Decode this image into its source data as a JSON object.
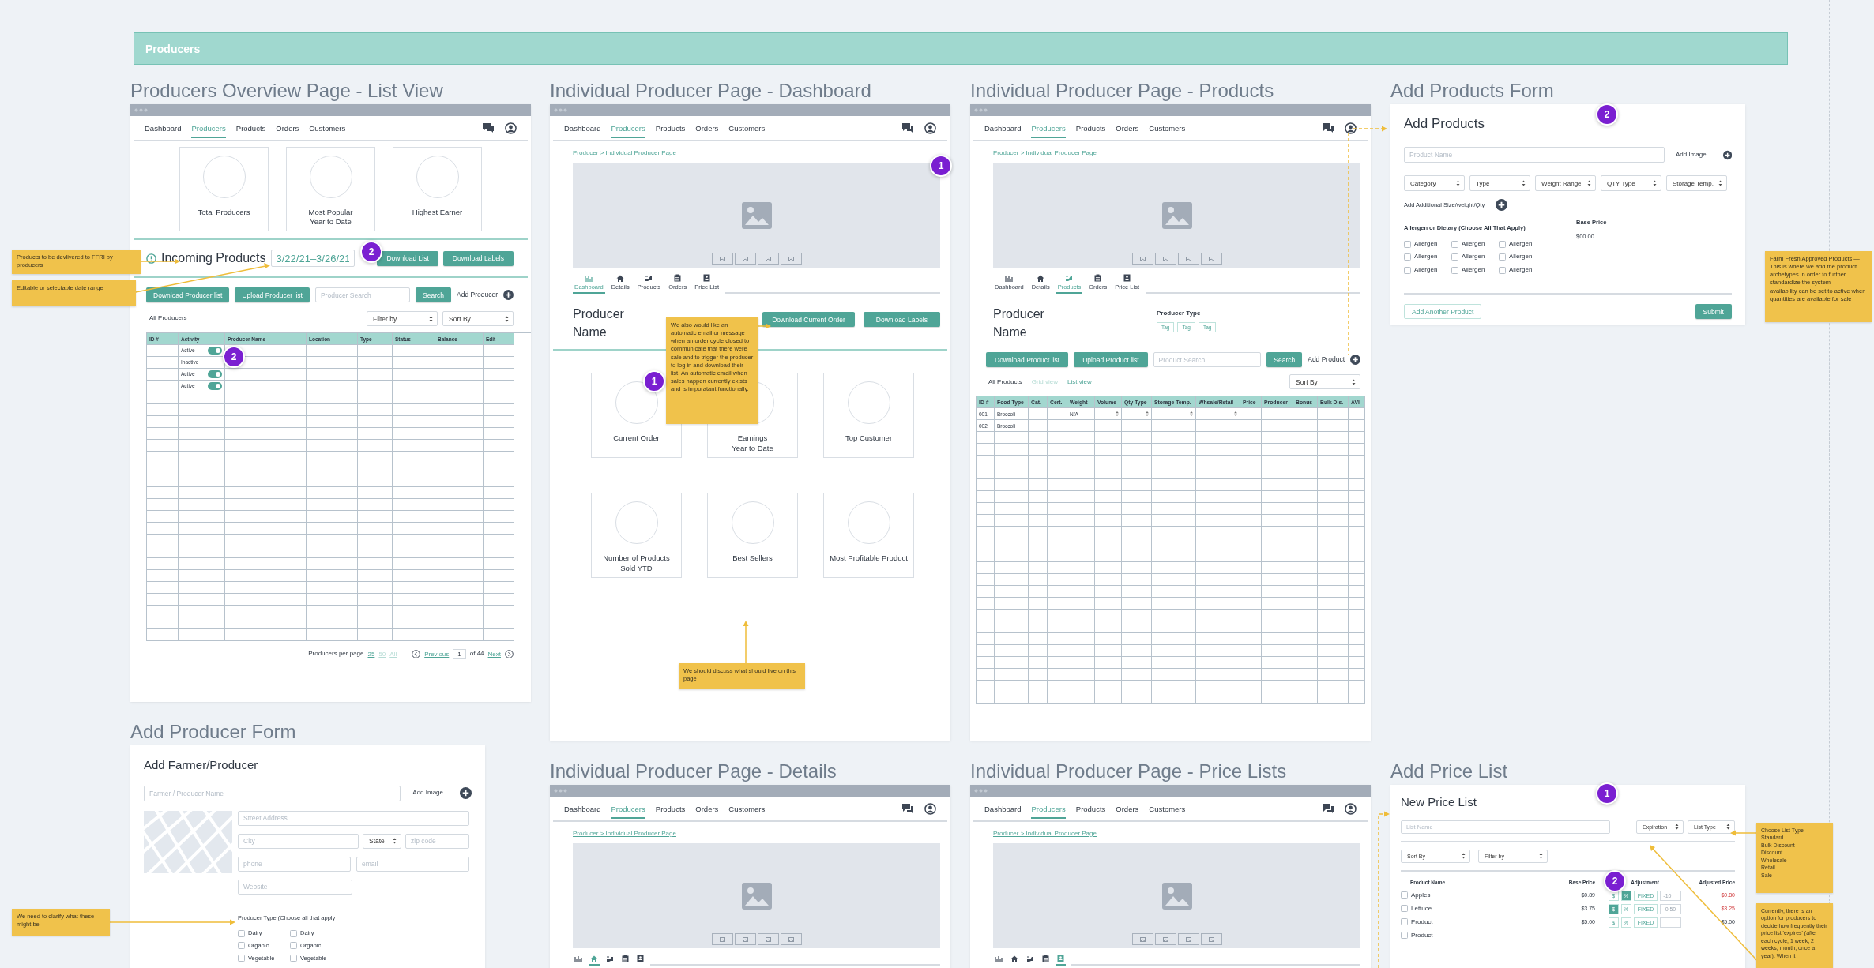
{
  "banner": {
    "title": "Producers"
  },
  "list_view": {
    "title": "Producers Overview Page - List View",
    "nav": [
      {
        "label": "Dashboard",
        "selected": false
      },
      {
        "label": "Producers",
        "selected": true
      },
      {
        "label": "Products",
        "selected": false
      },
      {
        "label": "Orders",
        "selected": false
      },
      {
        "label": "Customers",
        "selected": false
      }
    ],
    "stats": [
      "Total Producers",
      "Most Popular\nYear to Date",
      "Highest Earner"
    ],
    "incoming": {
      "label": "Incoming Products",
      "date_range": "3/22/21–3/26/21",
      "buttons": [
        "Download List",
        "Download Labels"
      ]
    },
    "actions": {
      "buttons": [
        "Download Producer list",
        "Upload Producer list"
      ],
      "search": {
        "placeholder": "Producer Search"
      },
      "search_button": "Search",
      "add": "Add Producer"
    },
    "list_label": "All Producers",
    "filters": [
      "Filter by",
      "Sort By"
    ],
    "table": {
      "columns": [
        "ID #",
        "Activity",
        "Producer Name",
        "Location",
        "Type",
        "Status",
        "Balance",
        "Edit"
      ],
      "rows": [
        {
          "activity": "Active",
          "on": true
        },
        {
          "activity": "Inactive"
        },
        {
          "activity": "Active",
          "on": true
        },
        {
          "activity": "Active",
          "on": true
        }
      ]
    },
    "pagination": {
      "label": "Producers per page",
      "sizes": [
        {
          "label": "25",
          "selected": true
        },
        {
          "label": "50",
          "selected": false
        },
        {
          "label": "All",
          "selected": false
        }
      ],
      "previous": "Previous",
      "page": "1",
      "of": "of 44",
      "next": "Next"
    }
  },
  "dashboard": {
    "title": "Individual Producer Page - Dashboard",
    "nav": [
      {
        "label": "Dashboard",
        "selected": false
      },
      {
        "label": "Producers",
        "selected": true
      },
      {
        "label": "Products",
        "selected": false
      },
      {
        "label": "Orders",
        "selected": false
      },
      {
        "label": "Customers",
        "selected": false
      }
    ],
    "breadcrumb": "Producer > Individual Producer Page",
    "tabs": [
      {
        "label": "Dashboard",
        "selected": true
      },
      {
        "label": "Details",
        "selected": false
      },
      {
        "label": "Products",
        "selected": false
      },
      {
        "label": "Orders",
        "selected": false
      },
      {
        "label": "Price List",
        "selected": false
      }
    ],
    "producer_name": "Producer\nName",
    "buttons": [
      "Download Current Order",
      "Download Labels"
    ],
    "stats": [
      "Current Order",
      "Earnings\nYear to Date",
      "Top Customer",
      "Number of Products\nSold YTD",
      "Best Sellers",
      "Most Profitable Product"
    ]
  },
  "products": {
    "title": "Individual Producer Page - Products",
    "nav": [
      {
        "label": "Dashboard",
        "selected": false
      },
      {
        "label": "Producers",
        "selected": true
      },
      {
        "label": "Products",
        "selected": false
      },
      {
        "label": "Orders",
        "selected": false
      },
      {
        "label": "Customers",
        "selected": false
      }
    ],
    "breadcrumb": "Producer > Individual Producer Page",
    "tabs": [
      {
        "label": "Dashboard",
        "selected": false
      },
      {
        "label": "Details",
        "selected": false
      },
      {
        "label": "Products",
        "selected": true
      },
      {
        "label": "Orders",
        "selected": false
      },
      {
        "label": "Price List",
        "selected": false
      }
    ],
    "producer_name": "Producer\nName",
    "producer_type": {
      "label": "Producer Type",
      "tags": [
        "Tag",
        "Tag",
        "Tag"
      ]
    },
    "buttons": [
      "Download Product list",
      "Upload Product list"
    ],
    "search": {
      "placeholder": "Product Search"
    },
    "search_button": "Search",
    "add": "Add Product",
    "list_label": "All Products",
    "views": [
      {
        "label": "Grid view",
        "selected": false
      },
      {
        "label": "List view",
        "selected": true
      }
    ],
    "sort": "Sort By",
    "table": {
      "columns": [
        "ID #",
        "Food Type",
        "Cat.",
        "Cert.",
        "Weight",
        "Volume",
        "Qty Type",
        "Storage Temp.",
        "Whsale/Retail",
        "Price",
        "Producer",
        "Bonus",
        "Bulk Dis.",
        "AVI"
      ],
      "rows": [
        {
          "id": "001",
          "food_type": "Broccoli",
          "weight": "N/A",
          "steppers": true
        },
        {
          "id": "002",
          "food_type": "Broccoli",
          "steppers": false
        }
      ]
    }
  },
  "add_products": {
    "title": "Add Products Form",
    "heading": "Add Products",
    "name_field": {
      "placeholder": "Product Name"
    },
    "add_image": "Add Image",
    "selects": [
      "Category",
      "Type",
      "Weight Range",
      "QTY Type",
      "Storage Temp."
    ],
    "add_size": "Add Additional Size/weight/Qty",
    "allergens": {
      "label": "Allergen or Dietary (Choose All That Apply)",
      "options": [
        {
          "label": "Allergen",
          "checked": false
        },
        {
          "label": "Allergen",
          "checked": false
        },
        {
          "label": "Allergen",
          "checked": false
        },
        {
          "label": "Allergen",
          "checked": false
        },
        {
          "label": "Allergen",
          "checked": false
        },
        {
          "label": "Allergen",
          "checked": false
        },
        {
          "label": "Allergen",
          "checked": false
        },
        {
          "label": "Allergen",
          "checked": false
        },
        {
          "label": "Allergen",
          "checked": false
        }
      ]
    },
    "base_price": {
      "label": "Base Price",
      "value": "$00.00"
    },
    "add_another": "Add Another Product",
    "submit": "Submit"
  },
  "add_producer": {
    "title": "Add Producer Form",
    "heading": "Add Farmer/Producer",
    "name_field": {
      "placeholder": "Farmer / Producer Name"
    },
    "add_image": "Add Image",
    "street": {
      "placeholder": "Street Address"
    },
    "city": {
      "placeholder": "City"
    },
    "state": "State",
    "zip": {
      "placeholder": "zip code"
    },
    "phone": {
      "placeholder": "phone"
    },
    "email": {
      "placeholder": "email"
    },
    "website": {
      "placeholder": "Website"
    },
    "producer_type": {
      "label": "Producer Type (Choose all that apply",
      "options": [
        {
          "label": "Dairy",
          "checked": false
        },
        {
          "label": "Dairy",
          "checked": false
        },
        {
          "label": "Organic",
          "checked": false
        },
        {
          "label": "Organic",
          "checked": false
        },
        {
          "label": "Vegetable",
          "checked": false
        },
        {
          "label": "Vegetable",
          "checked": false
        }
      ]
    }
  },
  "details": {
    "title": "Individual Producer Page - Details",
    "nav": [
      {
        "label": "Dashboard",
        "selected": false
      },
      {
        "label": "Producers",
        "selected": true
      },
      {
        "label": "Products",
        "selected": false
      },
      {
        "label": "Orders",
        "selected": false
      },
      {
        "label": "Customers",
        "selected": false
      }
    ],
    "breadcrumb": "Producer > Individual Producer Page",
    "tabs": [
      {
        "selected": false
      },
      {
        "selected": true
      },
      {
        "selected": false
      },
      {
        "selected": false
      },
      {
        "selected": false
      }
    ]
  },
  "price_lists": {
    "title": "Individual Producer Page - Price Lists",
    "nav": [
      {
        "label": "Dashboard",
        "selected": false
      },
      {
        "label": "Producers",
        "selected": true
      },
      {
        "label": "Products",
        "selected": false
      },
      {
        "label": "Orders",
        "selected": false
      },
      {
        "label": "Customers",
        "selected": false
      }
    ],
    "breadcrumb": "Producer > Individual Producer Page",
    "tabs": [
      {
        "selected": false
      },
      {
        "selected": false
      },
      {
        "selected": false
      },
      {
        "selected": false
      },
      {
        "selected": true
      }
    ]
  },
  "add_price_list": {
    "title": "Add Price List",
    "heading": "New Price List",
    "name_field": {
      "placeholder": "List Name"
    },
    "selects": [
      "Expiration",
      "List Type"
    ],
    "filters": [
      "Sort By",
      "Filter by"
    ],
    "columns": [
      "Product Name",
      "Base Price",
      "Adjustment",
      "Adjusted Price"
    ],
    "rows": [
      {
        "name": "Apples",
        "checked": false,
        "base": "$0.89",
        "units": [
          {
            "label": "$",
            "selected": false
          },
          {
            "label": "%",
            "selected": true
          }
        ],
        "type": "FIXED",
        "amount": "-10",
        "adjusted": "$0.80",
        "discounted": true
      },
      {
        "name": "Lettuce",
        "checked": false,
        "base": "$3.75",
        "units": [
          {
            "label": "$",
            "selected": true
          },
          {
            "label": "%",
            "selected": false
          }
        ],
        "type": "FIXED",
        "amount": "-0.50",
        "adjusted": "$3.25",
        "discounted": true
      },
      {
        "name": "Product",
        "checked": false,
        "base": "$5.00",
        "units": [
          {
            "label": "$",
            "selected": false
          },
          {
            "label": "%",
            "selected": false
          }
        ],
        "type": "FIXED",
        "adjusted": "$5.00",
        "discounted": false
      },
      {
        "name": "Product",
        "checked": false
      }
    ]
  },
  "notes": [
    {
      "text": "Products to be devlivered to FFRI by producers"
    },
    {
      "text": "Editable or selectable date range"
    },
    {
      "text": "We also would like an automatic email or message when an order cycle closed to communicate that there were sale and to trigger the producer to log in and download their list. An automatic email when sales happen currently exists and is imporatant functionally."
    },
    {
      "text": "We should discuss what should live on this page"
    },
    {
      "text": "Farm Fresh Approved Products — This is where we add the product archetypes in order to further standardize the system — availability can be set to active when quantities are available for sale"
    },
    {
      "text": "We need to clarify what these might be"
    },
    {
      "text": "Choose List Type\nStandard\nBulk Discount\nDiscount\nWholesale\nRetail\nSale"
    },
    {
      "text": "Currently, there is an option for producers to decide how frequently their price list 'expires' (after each cycle, 1 week, 2 weeks, month, once a year). When it"
    }
  ],
  "markers": [
    {
      "label": "2"
    },
    {
      "label": "2"
    },
    {
      "label": "1"
    },
    {
      "label": "1"
    },
    {
      "label": "2"
    },
    {
      "label": "1"
    },
    {
      "label": "2"
    }
  ]
}
